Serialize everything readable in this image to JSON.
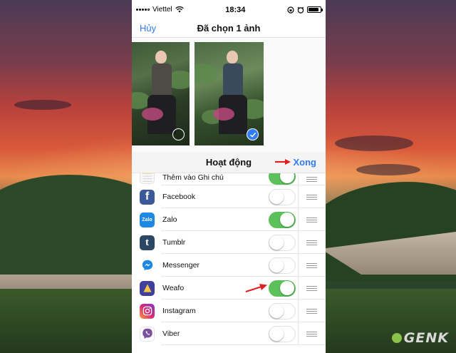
{
  "status_bar": {
    "carrier": "Viettel",
    "time": "18:34",
    "battery_level": 0.9
  },
  "nav": {
    "cancel_label": "Hủy",
    "title": "Đã chọn 1 ảnh"
  },
  "photos": [
    {
      "selected": false
    },
    {
      "selected": true
    }
  ],
  "sheet": {
    "title": "Hoạt động",
    "done_label": "Xong"
  },
  "activities": [
    {
      "label": "Thêm vào Ghi chú",
      "enabled": true,
      "icon": "notes-icon",
      "icon_color": "#f7f7f7"
    },
    {
      "label": "Facebook",
      "enabled": false,
      "icon": "facebook-icon",
      "icon_color": "#3b5998"
    },
    {
      "label": "Zalo",
      "enabled": true,
      "icon": "zalo-icon",
      "icon_color": "#1e88e5"
    },
    {
      "label": "Tumblr",
      "enabled": false,
      "icon": "tumblr-icon",
      "icon_color": "#2c4762"
    },
    {
      "label": "Messenger",
      "enabled": false,
      "icon": "messenger-icon",
      "icon_color": "#ffffff"
    },
    {
      "label": "Weafo",
      "enabled": true,
      "icon": "weafo-icon",
      "icon_color": "#3f3f9e"
    },
    {
      "label": "Instagram",
      "enabled": false,
      "icon": "instagram-icon",
      "icon_color": "#c13584"
    },
    {
      "label": "Viber",
      "enabled": false,
      "icon": "viber-icon",
      "icon_color": "#ffffff"
    }
  ],
  "colors": {
    "accent": "#2f7cf6",
    "toggle_on": "#5cc15b",
    "annotation_arrow": "#e02020"
  },
  "watermark": "GENK"
}
